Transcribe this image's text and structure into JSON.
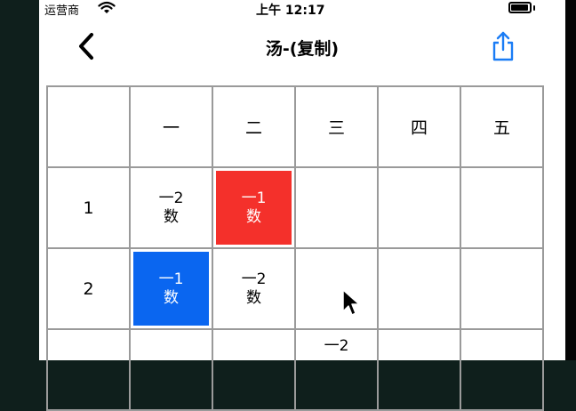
{
  "status": {
    "carrier": "运营商",
    "time": "上午 12:17"
  },
  "nav": {
    "title": "汤-(复制)"
  },
  "table": {
    "columns": [
      "",
      "一",
      "二",
      "三",
      "四",
      "五"
    ],
    "rows": [
      {
        "label": "1",
        "cells": [
          {
            "line1": "一2",
            "line2": "数",
            "color": "none"
          },
          {
            "line1": "一1",
            "line2": "数",
            "color": "#f4302b"
          },
          {
            "line1": "",
            "line2": "",
            "color": "none"
          },
          {
            "line1": "",
            "line2": "",
            "color": "none"
          },
          {
            "line1": "",
            "line2": "",
            "color": "none"
          }
        ]
      },
      {
        "label": "2",
        "cells": [
          {
            "line1": "一1",
            "line2": "数",
            "color": "#0a66f0"
          },
          {
            "line1": "一2",
            "line2": "数",
            "color": "none"
          },
          {
            "line1": "",
            "line2": "",
            "color": "none"
          },
          {
            "line1": "",
            "line2": "",
            "color": "none"
          },
          {
            "line1": "",
            "line2": "",
            "color": "none"
          }
        ]
      },
      {
        "label": "",
        "cells": [
          {
            "line1": "",
            "line2": "",
            "color": "none"
          },
          {
            "line1": "",
            "line2": "",
            "color": "none"
          },
          {
            "line1": "一2",
            "line2": "",
            "color": "none"
          },
          {
            "line1": "",
            "line2": "",
            "color": "none"
          },
          {
            "line1": "",
            "line2": "",
            "color": "none"
          }
        ]
      }
    ]
  }
}
